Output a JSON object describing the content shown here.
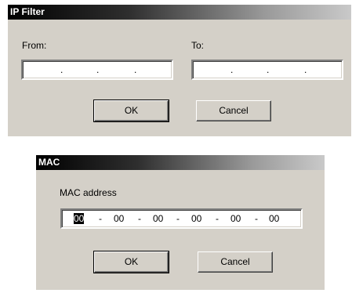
{
  "ip_dialog": {
    "title": "IP Filter",
    "from_label": "From:",
    "to_label": "To:",
    "dot": ".",
    "ok_label": "OK",
    "cancel_label": "Cancel"
  },
  "mac_dialog": {
    "title": "MAC",
    "address_label": "MAC address",
    "separator": "-",
    "octets": [
      "00",
      "00",
      "00",
      "00",
      "00",
      "00"
    ],
    "ok_label": "OK",
    "cancel_label": "Cancel"
  }
}
